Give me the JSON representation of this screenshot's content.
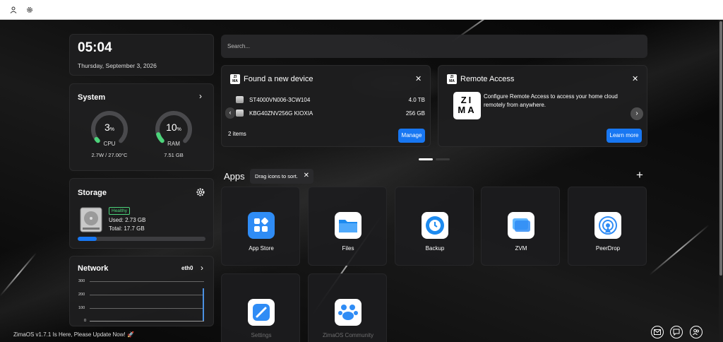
{
  "topbar": {
    "user_icon": "user-icon",
    "settings_icon": "gear-icon"
  },
  "clock": {
    "time": "05:04",
    "date": "Thursday, September 3, 2026"
  },
  "system": {
    "title": "System",
    "cpu": {
      "value": "3",
      "unit": "%",
      "label": "CPU",
      "detail": "2.7W / 27.00°C",
      "percent": 3
    },
    "ram": {
      "value": "10",
      "unit": "%",
      "label": "RAM",
      "detail": "7.51 GB",
      "percent": 10
    },
    "accent": "#4cd37a"
  },
  "storage": {
    "title": "Storage",
    "status": "Healthy",
    "used": "Used: 2.73 GB",
    "total": "Total: 17.7 GB",
    "used_fraction": 0.15
  },
  "network": {
    "title": "Network",
    "interface": "eth0",
    "ticks": [
      "300",
      "200",
      "100",
      "0"
    ]
  },
  "search": {
    "placeholder": "Search..."
  },
  "found_device": {
    "title": "Found a new device",
    "devices": [
      {
        "name": "ST4000VN006-3CW104",
        "size": "4.0 TB"
      },
      {
        "name": "KBG40ZNV256G KIOXIA",
        "size": "256 GB"
      }
    ],
    "count": "2 items",
    "button": "Manage"
  },
  "remote_access": {
    "title": "Remote Access",
    "logo_text": "ZIMA",
    "description": "Configure Remote Access to access your home cloud remotely from anywhere.",
    "button": "Learn more"
  },
  "apps": {
    "title": "Apps",
    "tooltip": "Drag icons to sort.",
    "items": [
      {
        "label": "App Store"
      },
      {
        "label": "Files"
      },
      {
        "label": "Backup"
      },
      {
        "label": "ZVM"
      },
      {
        "label": "PeerDrop"
      },
      {
        "label": "Settings"
      },
      {
        "label": "ZimaOS Community"
      }
    ]
  },
  "footer": {
    "update_text": "ZimaOS v1.7.1 Is Here, Please Update Now! 🚀"
  },
  "colors": {
    "accent_blue": "#1877f2",
    "healthy_green": "#4cd37a"
  }
}
